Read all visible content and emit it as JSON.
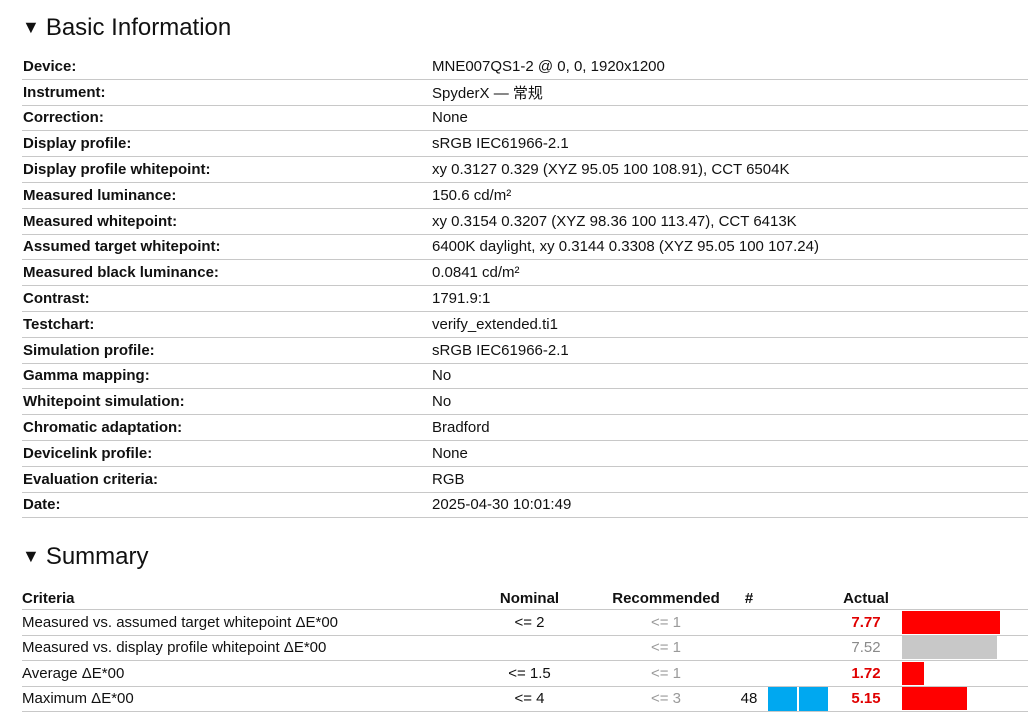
{
  "basic": {
    "title": "Basic Information",
    "rows": [
      {
        "label": "Device:",
        "value": "MNE007QS1-2 @ 0, 0, 1920x1200"
      },
      {
        "label": "Instrument:",
        "value": "SpyderX — 常规"
      },
      {
        "label": "Correction:",
        "value": "None"
      },
      {
        "label": "Display profile:",
        "value": "sRGB IEC61966-2.1"
      },
      {
        "label": "Display profile whitepoint:",
        "value": "xy 0.3127 0.329 (XYZ 95.05 100 108.91), CCT 6504K"
      },
      {
        "label": "Measured luminance:",
        "value": "150.6 cd/m²"
      },
      {
        "label": "Measured whitepoint:",
        "value": "xy 0.3154 0.3207 (XYZ 98.36 100 113.47), CCT 6413K"
      },
      {
        "label": "Assumed target whitepoint:",
        "value": "6400K daylight, xy 0.3144 0.3308 (XYZ 95.05 100 107.24)"
      },
      {
        "label": "Measured black luminance:",
        "value": "0.0841 cd/m²"
      },
      {
        "label": "Contrast:",
        "value": "1791.9:1"
      },
      {
        "label": "Testchart:",
        "value": "verify_extended.ti1"
      },
      {
        "label": "Simulation profile:",
        "value": "sRGB IEC61966-2.1"
      },
      {
        "label": "Gamma mapping:",
        "value": "No"
      },
      {
        "label": "Whitepoint simulation:",
        "value": "No"
      },
      {
        "label": "Chromatic adaptation:",
        "value": "Bradford"
      },
      {
        "label": "Devicelink profile:",
        "value": "None"
      },
      {
        "label": "Evaluation criteria:",
        "value": "RGB"
      },
      {
        "label": "Date:",
        "value": "2025-04-30 10:01:49"
      }
    ]
  },
  "summary": {
    "title": "Summary",
    "headers": {
      "criteria": "Criteria",
      "nominal": "Nominal",
      "recommended": "Recommended",
      "count": "#",
      "actual": "Actual"
    },
    "rows": [
      {
        "criteria": "Measured vs. assumed target whitepoint ΔE*00",
        "nominal": "<= 2",
        "recommended": "<= 1",
        "count": "",
        "actual": "7.77",
        "status": "fail",
        "bar_fraction": 1.0,
        "bar_color": "#ff0000"
      },
      {
        "criteria": "Measured vs. display profile whitepoint ΔE*00",
        "nominal": "",
        "recommended": "<= 1",
        "count": "",
        "actual": "7.52",
        "status": "info",
        "bar_fraction": 0.968,
        "bar_color": "#c8c8c8"
      },
      {
        "criteria": "Average ΔE*00",
        "nominal": "<= 1.5",
        "recommended": "<= 1",
        "count": "",
        "actual": "1.72",
        "status": "fail",
        "bar_fraction": 0.221,
        "bar_color": "#ff0000"
      },
      {
        "criteria": "Maximum ΔE*00",
        "nominal": "<= 4",
        "recommended": "<= 3",
        "count": "48",
        "actual": "5.15",
        "status": "fail",
        "bar_fraction": 0.663,
        "bar_color": "#ff0000",
        "count_bar_color": "#00a8f0"
      }
    ]
  },
  "colors": {
    "fail": "#e00000",
    "muted": "#8a8a8a",
    "bar_fail": "#ff0000",
    "bar_info": "#c8c8c8",
    "count_bar": "#00a8f0"
  }
}
